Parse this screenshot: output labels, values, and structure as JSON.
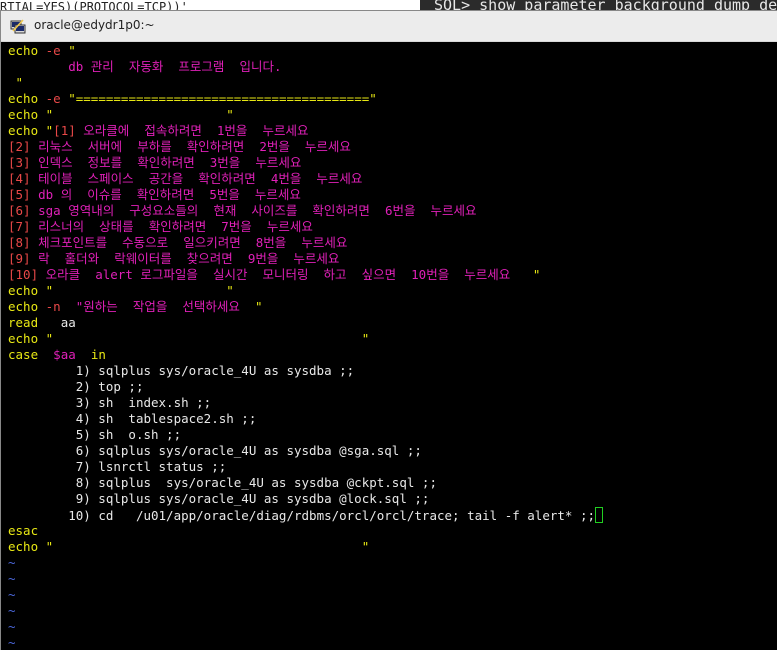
{
  "background": {
    "left_line": "RTIAL=YES)(PROTOCOL=TCP))'",
    "right_line": "SQL> show parameter background_dump_dest"
  },
  "window": {
    "title": "oracle@edydr1p0:~",
    "icon": "putty-terminal-icon"
  },
  "colors": {
    "keyword": "#e8e814",
    "string_text": "#e020b8",
    "option": "#e84848",
    "plain": "#e8e8e8",
    "tilde": "#4a66d8",
    "cursor": "#21d021"
  },
  "script": {
    "l1": "echo",
    "l1_opt": "-e",
    "l1_q": "\"",
    "l2": "db 관리  자동화  프로그램  입니다.",
    "l3": "\"",
    "l4": "echo",
    "l4_opt": "-e",
    "l4_q": "\"=======================================\"",
    "l5a": "echo",
    "l5b": "\"                       \"",
    "l6a": "echo",
    "l6b": "\"",
    "l6c": "[1]",
    "l6d": "오라클에  접속하려면  1번을  누르세요",
    "l7a": "[2]",
    "l7b": "리눅스  서버에  부하를  확인하려면  2번을  누르세요",
    "l8a": "[3]",
    "l8b": "인덱스  정보를  확인하려면  3번을  누르세요",
    "l9a": "[4]",
    "l9b": "테이블  스페이스  공간을  확인하려면  4번을  누르세요",
    "l10a": "[5]",
    "l10b": "db",
    "l10c": "의  이슈를  확인하려면  5번을  누르세요",
    "l11a": "[6]",
    "l11b": "sga",
    "l11c": "영역내의  구성요소들의  현재  사이즈를  확인하려면  6번을  누르세요",
    "l12a": "[7]",
    "l12b": "리스너의  상태를  확인하려면  7번을  누르세요",
    "l13a": "[8]",
    "l13b": "체크포인트를  수동으로  일으키려면  8번을  누르세요",
    "l14a": "[9]",
    "l14b": "락  홀더와  락웨이터를  찾으려면  9번을  누르세요",
    "l15a": "[10]",
    "l15b": "오라클",
    "l15c": "alert",
    "l15d": "로그파일을  실시간  모니터링  하고  싶으면  10번을  누르세요",
    "l15e": "\"",
    "l16a": "echo",
    "l16b": "\"                       \"",
    "l17a": "echo",
    "l17b": "-n",
    "l17c": "\"원하는  작업을  선택하세요",
    "l17d": "\"",
    "l18a": "read",
    "l18b": "aa",
    "l19a": "echo",
    "l19b": "\"                                         \"",
    "l20a": "case",
    "l20b": "$aa",
    "l20c": "in",
    "c1": "1) sqlplus sys/oracle_4U as sysdba ;;",
    "c2": "2) top ;;",
    "c3": "3) sh  index.sh ;;",
    "c4": "4) sh  tablespace2.sh ;;",
    "c5": "5) sh  o.sh ;;",
    "c6": "6) sqlplus sys/oracle_4U as sysdba @sga.sql ;;",
    "c7": "7) lsnrctl status ;;",
    "c8": "8) sqlplus  sys/oracle_4U as sysdba @ckpt.sql ;;",
    "c9": "9) sqlplus sys/oracle_4U as sysdba @lock.sql ;;",
    "c10": "10) cd   /u01/app/oracle/diag/rdbms/orcl/orcl/trace; tail -f alert* ;;",
    "esac": "esac",
    "l_last_a": "echo",
    "l_last_b": "\"                                         \"",
    "tilde": "~"
  }
}
